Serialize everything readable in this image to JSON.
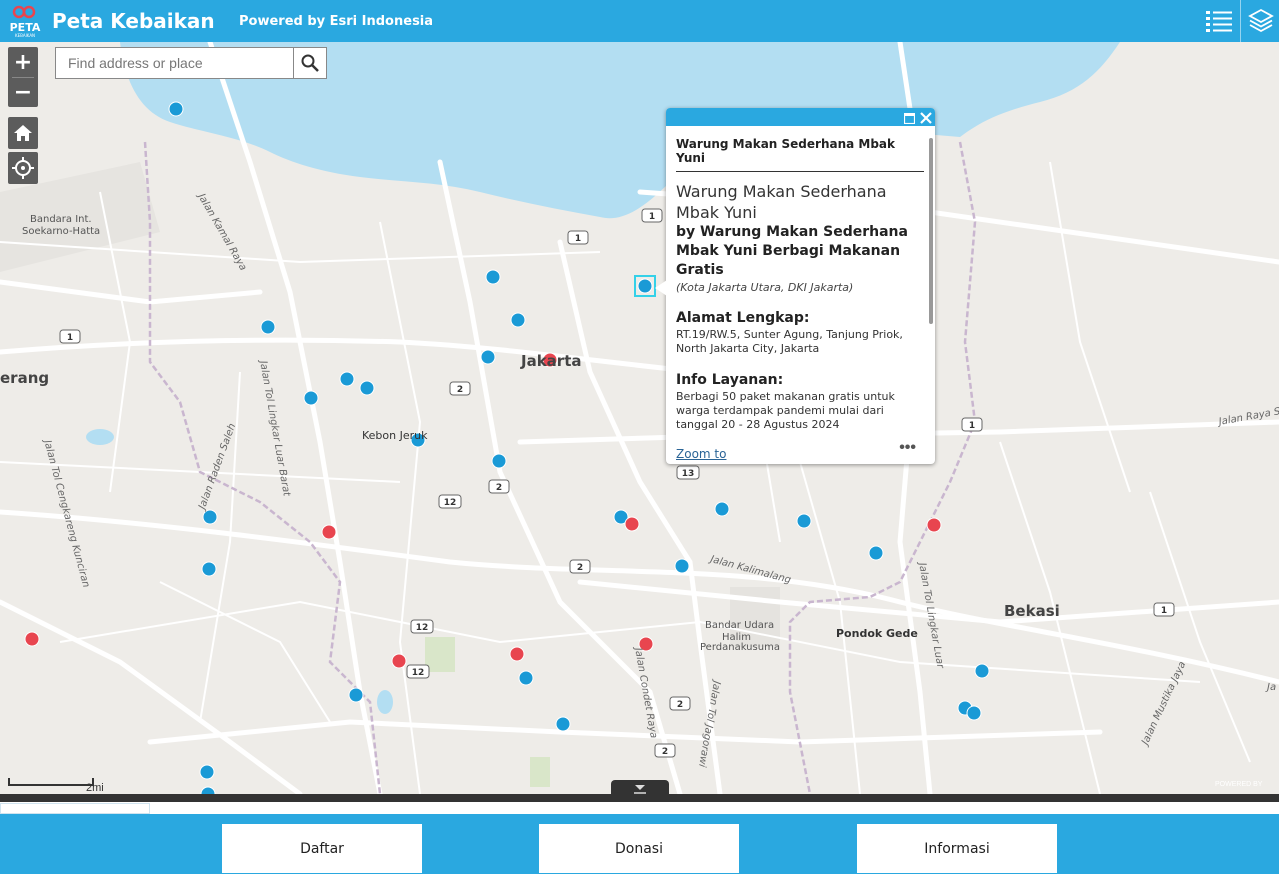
{
  "app": {
    "title": "Peta Kebaikan",
    "logo_text": "PETA",
    "logo_subtext": "KEBAIKAN",
    "powered_by": "Powered by Esri Indonesia",
    "brand_color": "#2aa8e0"
  },
  "toolbar": {
    "legend_icon": "list-icon",
    "layers_icon": "layers-icon"
  },
  "map_controls": {
    "zoom_in": "+",
    "zoom_out": "−",
    "home_icon": "home-icon",
    "locate_icon": "locate-icon"
  },
  "search": {
    "placeholder": "Find address or place",
    "value": ""
  },
  "map_labels": {
    "jakarta": "Jakarta",
    "bekasi": "Bekasi",
    "tangerang": "erang",
    "kebon_jeruk": "Kebon Jeruk",
    "pondok_gede": "Pondok Gede",
    "airport1": "Bandara Int.",
    "airport2": "Soekarno-Hatta",
    "halim1": "Bandar Udara",
    "halim2": "Halim",
    "halim3": "Perdanakusuma",
    "jalan_kamal": "Jalan Kamal Raya",
    "jalan_tol_lingkar_barat": "Jalan Tol Lingkar Luar Barat",
    "jalan_raden_saleh": "Jalan Raden Saleh",
    "jalan_tol_cengkareng": "Jalan Tol Cengkareng Kunciran",
    "jalan_kalimalang": "Jalan Kalimalang",
    "jalan_condet": "Jalan Condet Raya",
    "jalan_tol_jagorawi": "Jalan Tol Jagorawi",
    "jalan_tol_lingkar_luar": "Jalan Tol Lingkar Luar",
    "jalan_mustika": "Jalan Mustika Jaya",
    "jalan_raya_s": "Jalan Raya S",
    "edge_ja": "Ja",
    "scale": "2mi",
    "esri": "POWERED BY"
  },
  "route_shields": [
    "1",
    "1",
    "1",
    "1",
    "1",
    "2",
    "2",
    "2",
    "2",
    "2",
    "12",
    "12",
    "12",
    "13"
  ],
  "popup": {
    "header_title": "Warung Makan Sederhana Mbak Yuni",
    "name": "Warung Makan Sederhana Mbak Yuni",
    "by": "by Warung Makan Sederhana Mbak Yuni Berbagi Makanan Gratis",
    "location": "(Kota Jakarta Utara, DKI Jakarta)",
    "address_heading": "Alamat Lengkap:",
    "address": "RT.19/RW.5, Sunter Agung, Tanjung Priok, North Jakarta City, Jakarta",
    "service_heading": "Info Layanan:",
    "service": "Berbagi 50 paket makanan gratis untuk warga terdampak pandemi mulai dari tanggal 20 - 28 Agustus 2024",
    "zoom_to": "Zoom to",
    "more": "•••"
  },
  "colors": {
    "blue_point": "#1a9ad6",
    "red_point": "#e8454f",
    "water": "#b3def2"
  },
  "bottom_tabs": {
    "daftar": "Daftar",
    "donasi": "Donasi",
    "informasi": "Informasi"
  }
}
